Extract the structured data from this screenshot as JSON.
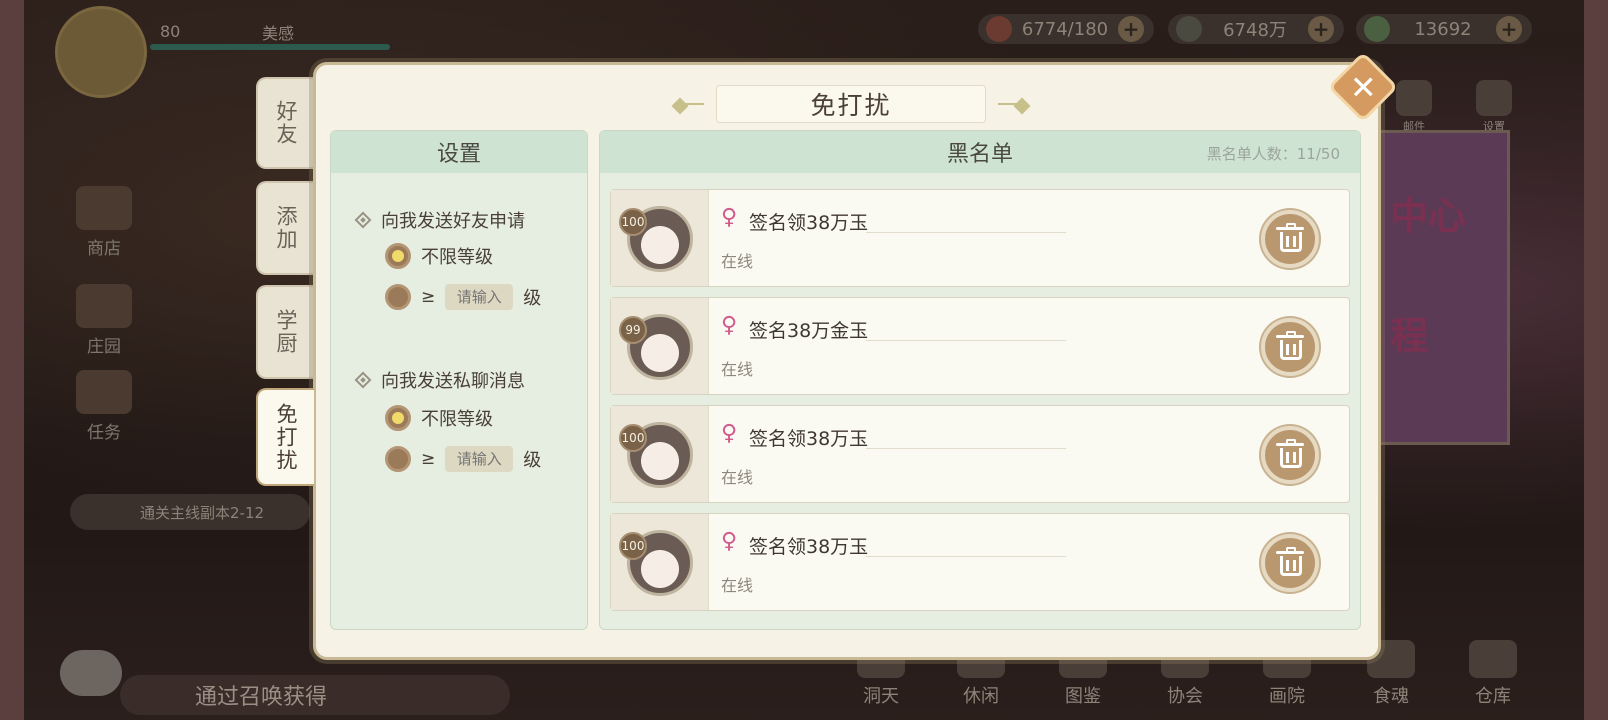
{
  "hud": {
    "player_level": "80",
    "player_name": "美感",
    "resources": [
      {
        "value": "6774/180",
        "icon": "heart-stamina-icon"
      },
      {
        "value": "6748万",
        "icon": "leaf-coin-icon"
      },
      {
        "value": "13692",
        "icon": "jade-gem-icon"
      }
    ],
    "side_menu": [
      "商店",
      "庄园",
      "任务"
    ],
    "quest_text": "通关主线副本2-12",
    "chat_text": "通过召唤获得",
    "bottom_nav": [
      "洞天",
      "休闲",
      "图鉴",
      "协会",
      "画院",
      "食魂",
      "仓库"
    ],
    "right_icons": [
      "邮件",
      "设置"
    ],
    "poster_text": [
      "中心",
      "程"
    ]
  },
  "tabs": [
    {
      "label": "好友",
      "active": false
    },
    {
      "label": "添加",
      "active": false
    },
    {
      "label": "学厨",
      "active": false
    },
    {
      "label": "免打扰",
      "active": true
    }
  ],
  "dialog": {
    "title": "免打扰",
    "close_label": "✕"
  },
  "settings": {
    "header": "设置",
    "friend_request": {
      "title": "向我发送好友申请",
      "option_unlimited": "不限等级",
      "option_ge": "≥",
      "input_placeholder": "请输入",
      "level_suffix": "级",
      "selected": "unlimited"
    },
    "private_message": {
      "title": "向我发送私聊消息",
      "option_unlimited": "不限等级",
      "option_ge": "≥",
      "input_placeholder": "请输入",
      "level_suffix": "级",
      "selected": "unlimited"
    }
  },
  "blacklist": {
    "header": "黑名单",
    "count_label": "黑名单人数：11/50",
    "rows": [
      {
        "level": "100",
        "gender": "♀",
        "name": "签名领38万玉",
        "status": "在线"
      },
      {
        "level": "99",
        "gender": "♀",
        "name": "签名38万金玉",
        "status": "在线"
      },
      {
        "level": "100",
        "gender": "♀",
        "name": "签名领38万玉",
        "status": "在线"
      },
      {
        "level": "100",
        "gender": "♀",
        "name": "签名领38万玉",
        "status": "在线"
      }
    ]
  },
  "colors": {
    "panel_header": "#cfe3d3",
    "dialog_bg": "#f6f2e6",
    "close_button": "#d59a5f",
    "delete_button": "#b99870",
    "female_icon": "#d05a8c"
  }
}
